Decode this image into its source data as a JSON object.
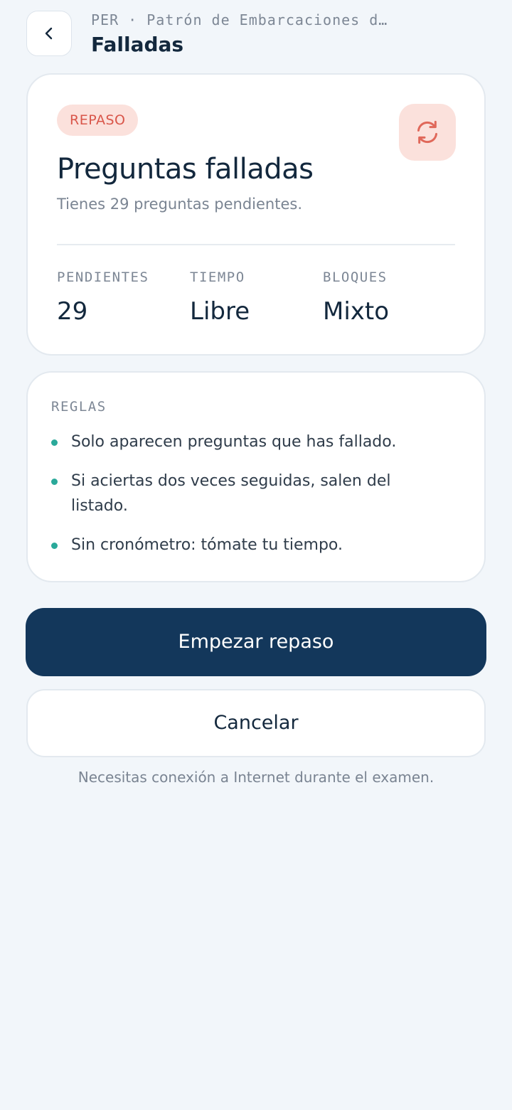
{
  "header": {
    "breadcrumb": "PER · Patrón de Embarcaciones d…",
    "title": "Falladas",
    "back_icon": "chevron-left-icon"
  },
  "summary_card": {
    "badge": "REPASO",
    "action_icon": "refresh-icon",
    "title": "Preguntas falladas",
    "subtitle": "Tienes 29 preguntas pendientes.",
    "stats": [
      {
        "label": "PENDIENTES",
        "value": "29"
      },
      {
        "label": "TIEMPO",
        "value": "Libre"
      },
      {
        "label": "BLOQUES",
        "value": "Mixto"
      }
    ]
  },
  "rules_card": {
    "heading": "REGLAS",
    "items": [
      "Solo aparecen preguntas que has fallado.",
      "Si aciertas dos veces seguidas, salen del listado.",
      "Sin cronómetro: tómate tu tiempo."
    ]
  },
  "actions": {
    "primary_label": "Empezar repaso",
    "secondary_label": "Cancelar"
  },
  "footnote": "Necesitas conexión a Internet durante el examen.",
  "colors": {
    "background": "#f2f6fa",
    "primary_button": "#13375b",
    "badge_bg": "#fbe1dc",
    "badge_text": "#d9564a",
    "bullet": "#2aa99a"
  }
}
